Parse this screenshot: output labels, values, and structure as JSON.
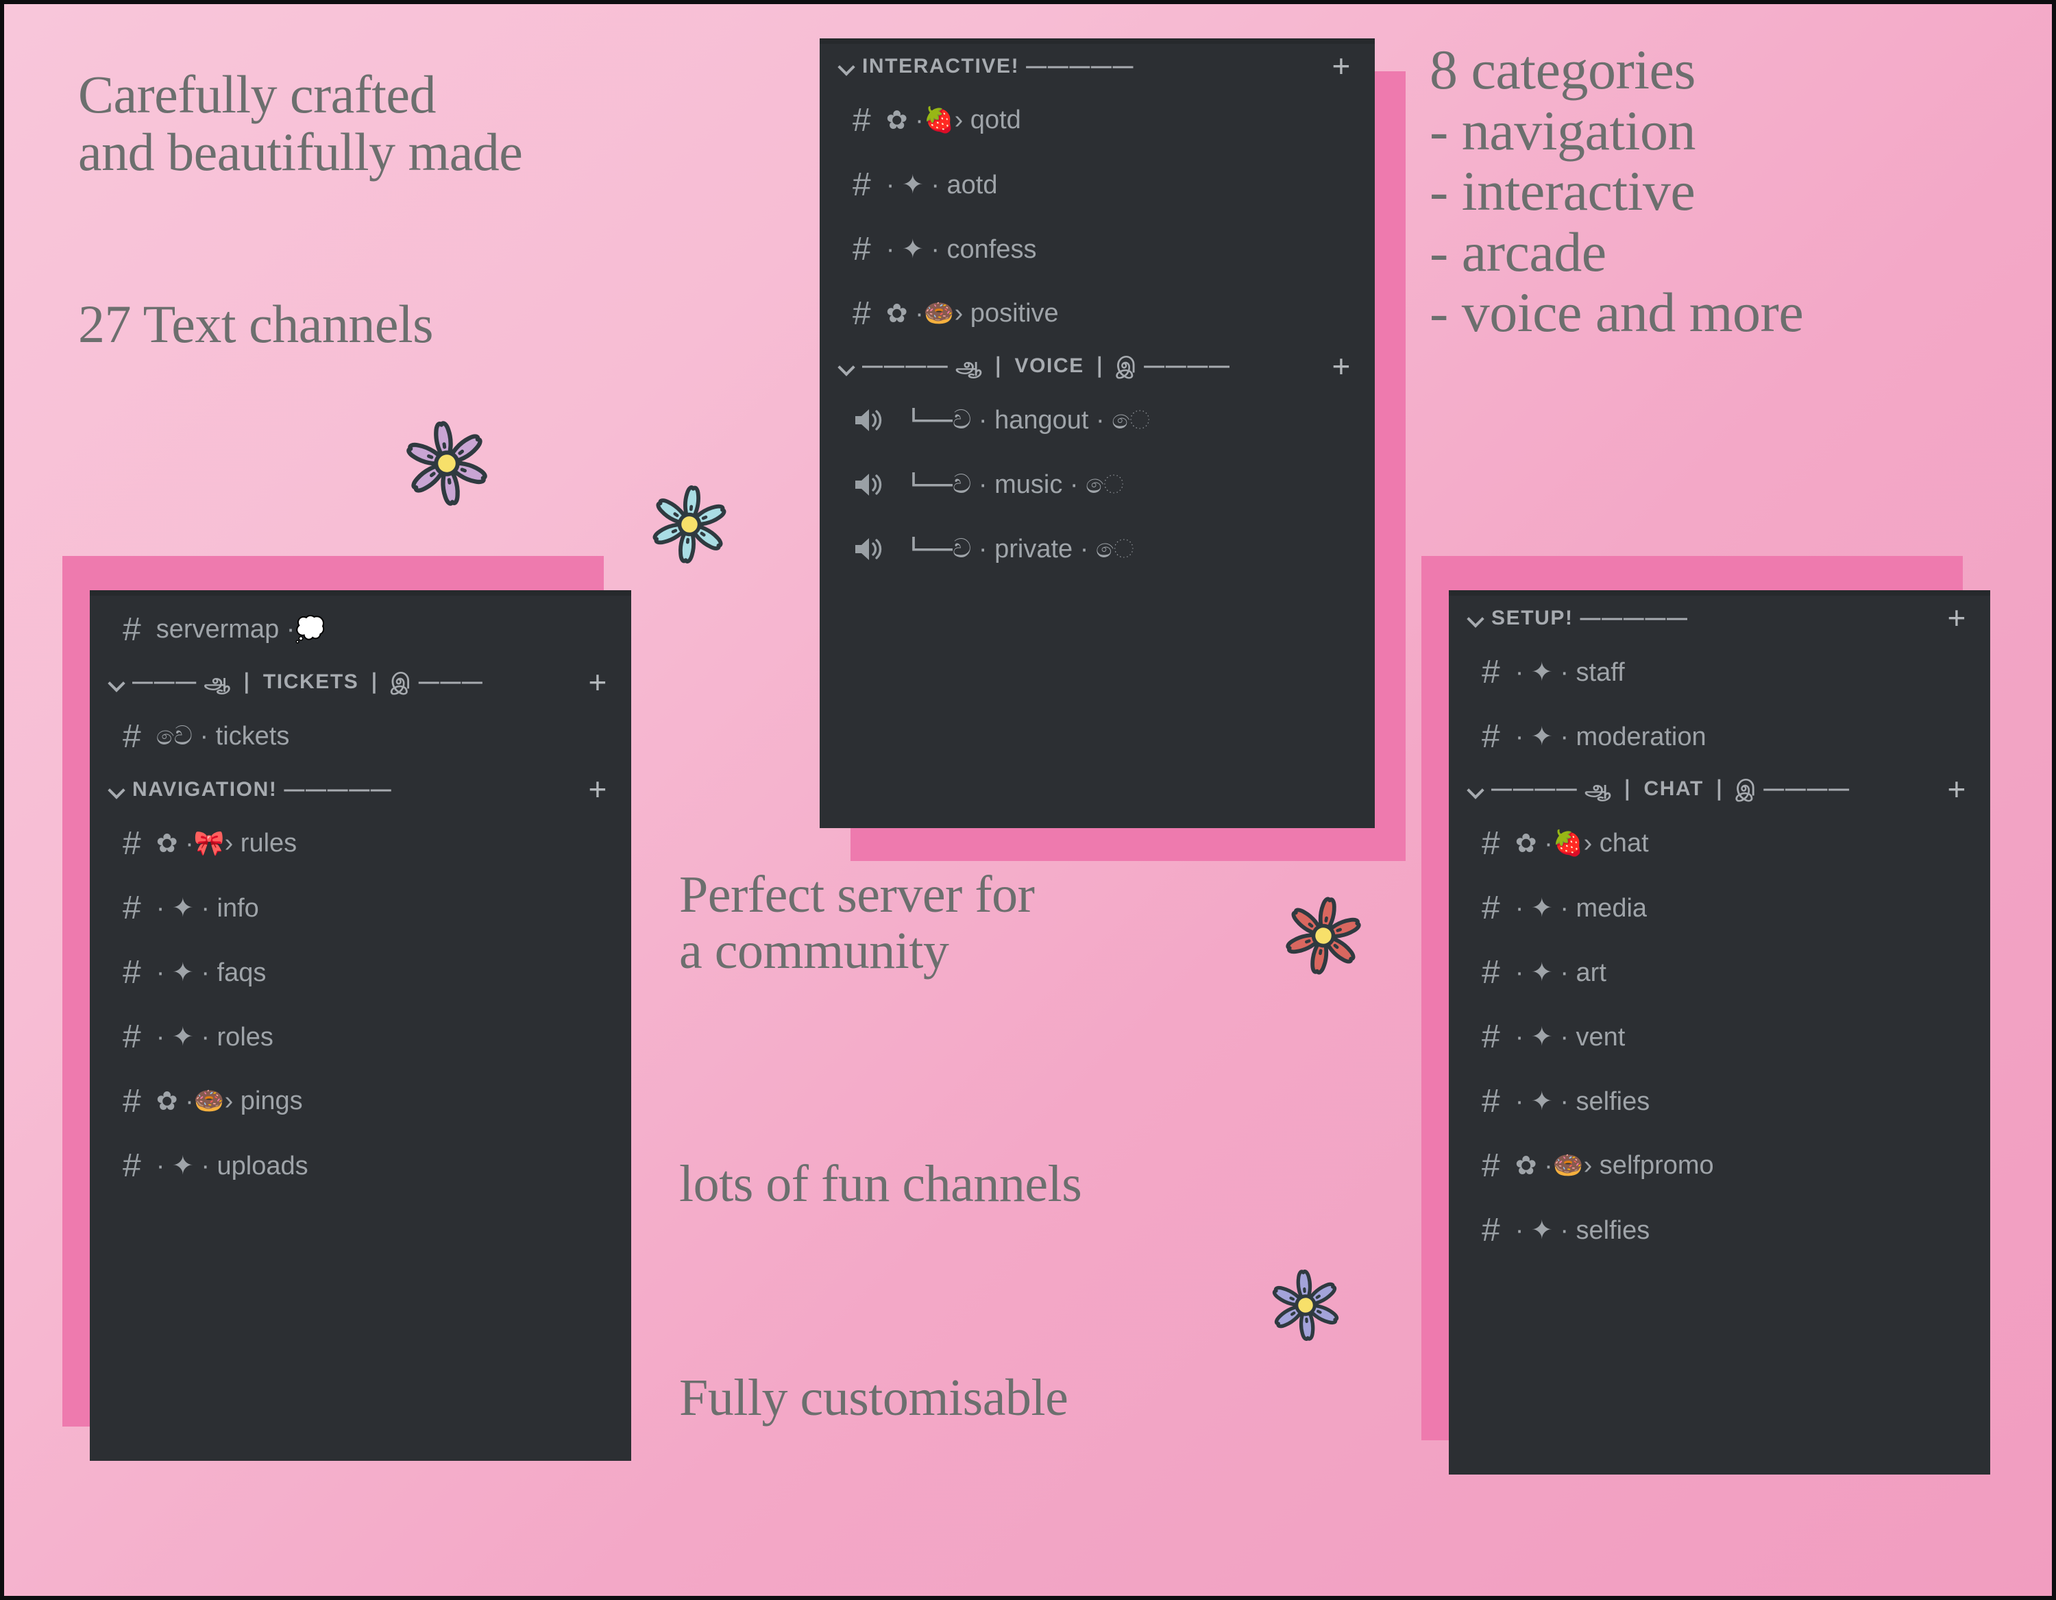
{
  "poster": {
    "background_gradient": [
      "#f8c6da",
      "#f19dc0"
    ],
    "border_color": "#0d0d10",
    "text_color": "#6c6f6e",
    "panel_bg": "#2c2f33",
    "panel_shadow_color": "#ee7aae",
    "channel_text_color": "#9fa4a9"
  },
  "headlines": {
    "crafted": "Carefully crafted\nand beautifully made",
    "text_channels": "27 Text channels",
    "categories": "8 categories\n- navigation\n- interactive\n- arcade\n- voice and more",
    "perfect_server": "Perfect server for\na community",
    "fun_channels": "lots of fun channels",
    "fully_customisable": "Fully customisable"
  },
  "panels": {
    "left": {
      "name": "left-channel-panel",
      "groups": [
        {
          "type": "loose",
          "channels": [
            {
              "icon": "hash-icon",
              "prefix": "",
              "emoji": "💭",
              "emoji_name": "thought-balloon-emoji",
              "pre_text": "servermap · ",
              "post_text": "",
              "label": "servermap"
            }
          ]
        },
        {
          "type": "category",
          "header": "——— ஆ ❘ TICKETS ❘ இ ———",
          "header_label": "TICKETS",
          "add_button": "+",
          "channels": [
            {
              "icon": "hash-icon",
              "pre_text": "වෙ · tickets",
              "label": "tickets"
            }
          ]
        },
        {
          "type": "category",
          "header": "NAVIGATION! —————",
          "header_label": "NAVIGATION!",
          "add_button": "+",
          "channels": [
            {
              "icon": "hash-icon",
              "pre_text": "✿ · ",
              "emoji": "🎀",
              "emoji_name": "ribbon-bow-emoji",
              "post_text": " › rules",
              "label": "rules"
            },
            {
              "icon": "hash-icon",
              "pre_text": "· ✦ · info",
              "label": "info"
            },
            {
              "icon": "hash-icon",
              "pre_text": "· ✦ · faqs",
              "label": "faqs"
            },
            {
              "icon": "hash-icon",
              "pre_text": "· ✦ · roles",
              "label": "roles"
            },
            {
              "icon": "hash-icon",
              "pre_text": "✿ · ",
              "emoji": "🍩",
              "emoji_name": "doughnut-emoji",
              "post_text": " › pings",
              "label": "pings"
            },
            {
              "icon": "hash-icon",
              "pre_text": "· ✦ · uploads",
              "label": "uploads"
            }
          ]
        }
      ]
    },
    "middle": {
      "name": "middle-channel-panel",
      "groups": [
        {
          "type": "category",
          "header": "INTERACTIVE! —————",
          "header_label": "INTERACTIVE!",
          "add_button": "+",
          "channels": [
            {
              "icon": "hash-icon",
              "pre_text": "✿ · ",
              "emoji": "🍓",
              "emoji_name": "strawberry-emoji",
              "post_text": " › qotd",
              "label": "qotd"
            },
            {
              "icon": "hash-icon",
              "pre_text": "· ✦ · aotd",
              "label": "aotd"
            },
            {
              "icon": "hash-icon",
              "pre_text": "· ✦ · confess",
              "label": "confess"
            },
            {
              "icon": "hash-icon",
              "pre_text": "✿ · ",
              "emoji": "🍩",
              "emoji_name": "doughnut-emoji",
              "post_text": " › positive",
              "label": "positive"
            }
          ]
        },
        {
          "type": "category",
          "header": "———— ஆ ❘ VOICE ❘ இ ————",
          "header_label": "VOICE",
          "add_button": "+",
          "channels": [
            {
              "icon": "speaker-icon",
              "pre_text": "┗━ව · hangout · ෙ",
              "label": "hangout"
            },
            {
              "icon": "speaker-icon",
              "pre_text": "┗━ව · music · ෙ",
              "label": "music"
            },
            {
              "icon": "speaker-icon",
              "pre_text": "┗━ව · private · ෙ",
              "label": "private"
            }
          ]
        }
      ]
    },
    "right": {
      "name": "right-channel-panel",
      "groups": [
        {
          "type": "category",
          "header": "SETUP! —————",
          "header_label": "SETUP!",
          "add_button": "+",
          "channels": [
            {
              "icon": "hash-icon",
              "pre_text": "· ✦ · staff",
              "label": "staff"
            },
            {
              "icon": "hash-icon",
              "pre_text": "· ✦ · moderation",
              "label": "moderation"
            }
          ]
        },
        {
          "type": "category",
          "header": "———— ஆ ❘ CHAT ❘ இ ————",
          "header_label": "CHAT",
          "add_button": "+",
          "channels": [
            {
              "icon": "hash-icon",
              "pre_text": "✿ · ",
              "emoji": "🍓",
              "emoji_name": "strawberry-emoji",
              "post_text": " › chat",
              "label": "chat"
            },
            {
              "icon": "hash-icon",
              "pre_text": "· ✦ · media",
              "label": "media"
            },
            {
              "icon": "hash-icon",
              "pre_text": "· ✦ · art",
              "label": "art"
            },
            {
              "icon": "hash-icon",
              "pre_text": "· ✦ · vent",
              "label": "vent"
            },
            {
              "icon": "hash-icon",
              "pre_text": "· ✦ · selfies",
              "label": "selfies"
            },
            {
              "icon": "hash-icon",
              "pre_text": "✿ · ",
              "emoji": "🍩",
              "emoji_name": "doughnut-emoji",
              "post_text": " › selfpromo",
              "label": "selfpromo"
            },
            {
              "icon": "hash-icon",
              "pre_text": "· ✦ · selfies",
              "label": "selfies"
            }
          ]
        }
      ]
    }
  },
  "stickers": [
    {
      "name": "flower-sticker-purple",
      "petal": "#c9a5d4",
      "petal_dark": "#bb92c9",
      "center": "#f7e06a",
      "outline": "#2f3a40"
    },
    {
      "name": "flower-sticker-lightblue",
      "petal": "#a9dde4",
      "petal_dark": "#97d2db",
      "center": "#f7e06a",
      "outline": "#2f3a40"
    },
    {
      "name": "flower-sticker-red",
      "petal": "#d9675f",
      "petal_dark": "#cd5a53",
      "center": "#f7e06a",
      "outline": "#2f3a40"
    },
    {
      "name": "flower-sticker-periwinkle",
      "petal": "#a3a3da",
      "petal_dark": "#9393d0",
      "center": "#f7e06a",
      "outline": "#2f3a40"
    }
  ]
}
